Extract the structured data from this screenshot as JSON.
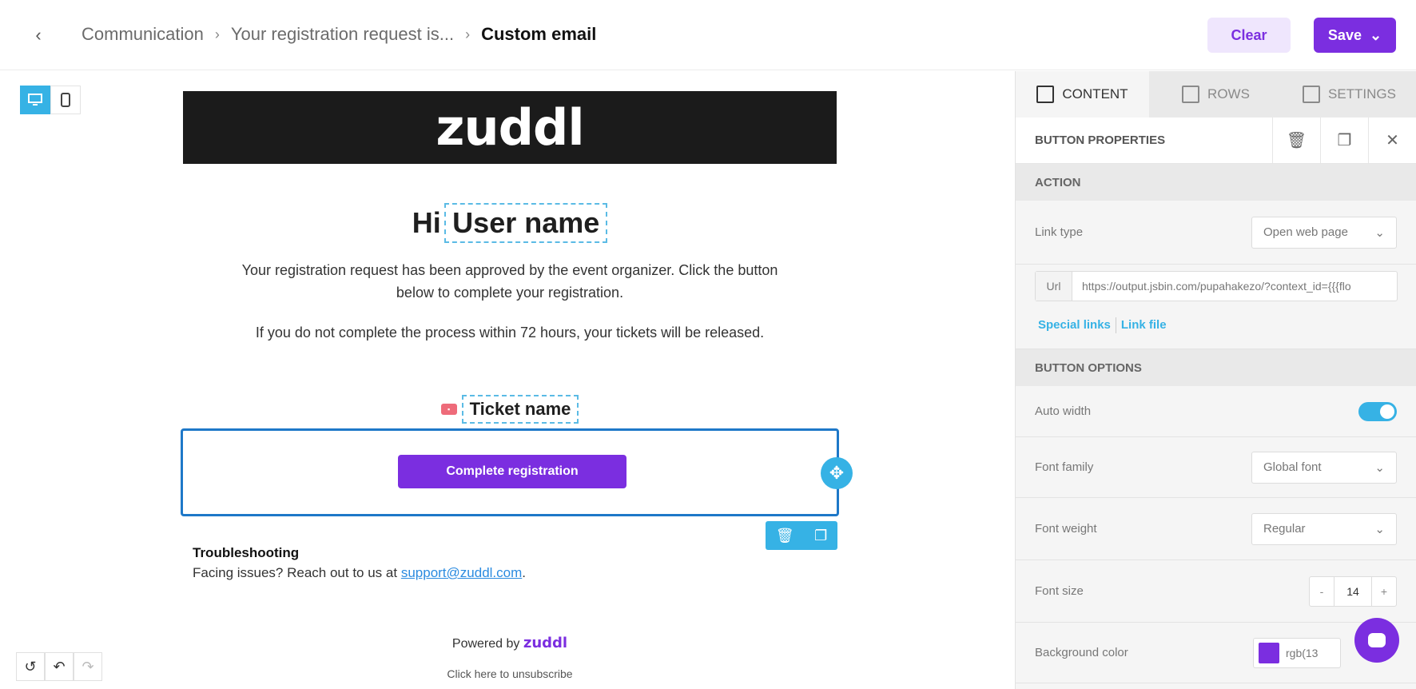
{
  "header": {
    "breadcrumbs": [
      "Communication",
      "Your registration request is...",
      "Custom email"
    ],
    "clear_label": "Clear",
    "save_label": "Save"
  },
  "email": {
    "logo_text": "zuddl",
    "greeting_prefix": "Hi",
    "greeting_merge": "User name",
    "paragraph1": "Your registration request has been approved by the event organizer. Click the button below to complete your registration.",
    "paragraph2": "If you do not complete the process within 72 hours, your tickets will be released.",
    "ticket_merge": "Ticket name",
    "cta_label": "Complete registration",
    "trouble_title": "Troubleshooting",
    "trouble_text": "Facing issues? Reach out to us at",
    "support_email": "support@zuddl.com",
    "trouble_suffix": ".",
    "powered_by": "Powered by",
    "powered_brand": "zuddl",
    "unsubscribe": "Click here to unsubscribe"
  },
  "panel": {
    "tabs": [
      "CONTENT",
      "ROWS",
      "SETTINGS"
    ],
    "properties_title": "BUTTON PROPERTIES",
    "action_section": "ACTION",
    "link_type_label": "Link type",
    "link_type_value": "Open web page",
    "url_label": "Url",
    "url_value": "https://output.jsbin.com/pupahakezo/?context_id={{{flo",
    "special_links": "Special links",
    "link_file": "Link file",
    "options_section": "BUTTON OPTIONS",
    "auto_width_label": "Auto width",
    "font_family_label": "Font family",
    "font_family_value": "Global font",
    "font_weight_label": "Font weight",
    "font_weight_value": "Regular",
    "font_size_label": "Font size",
    "font_size_value": "14",
    "bg_color_label": "Background color",
    "bg_color_value": "rgb(13"
  },
  "colors": {
    "accent": "#7b2ee0",
    "selection": "#36b2e5"
  }
}
